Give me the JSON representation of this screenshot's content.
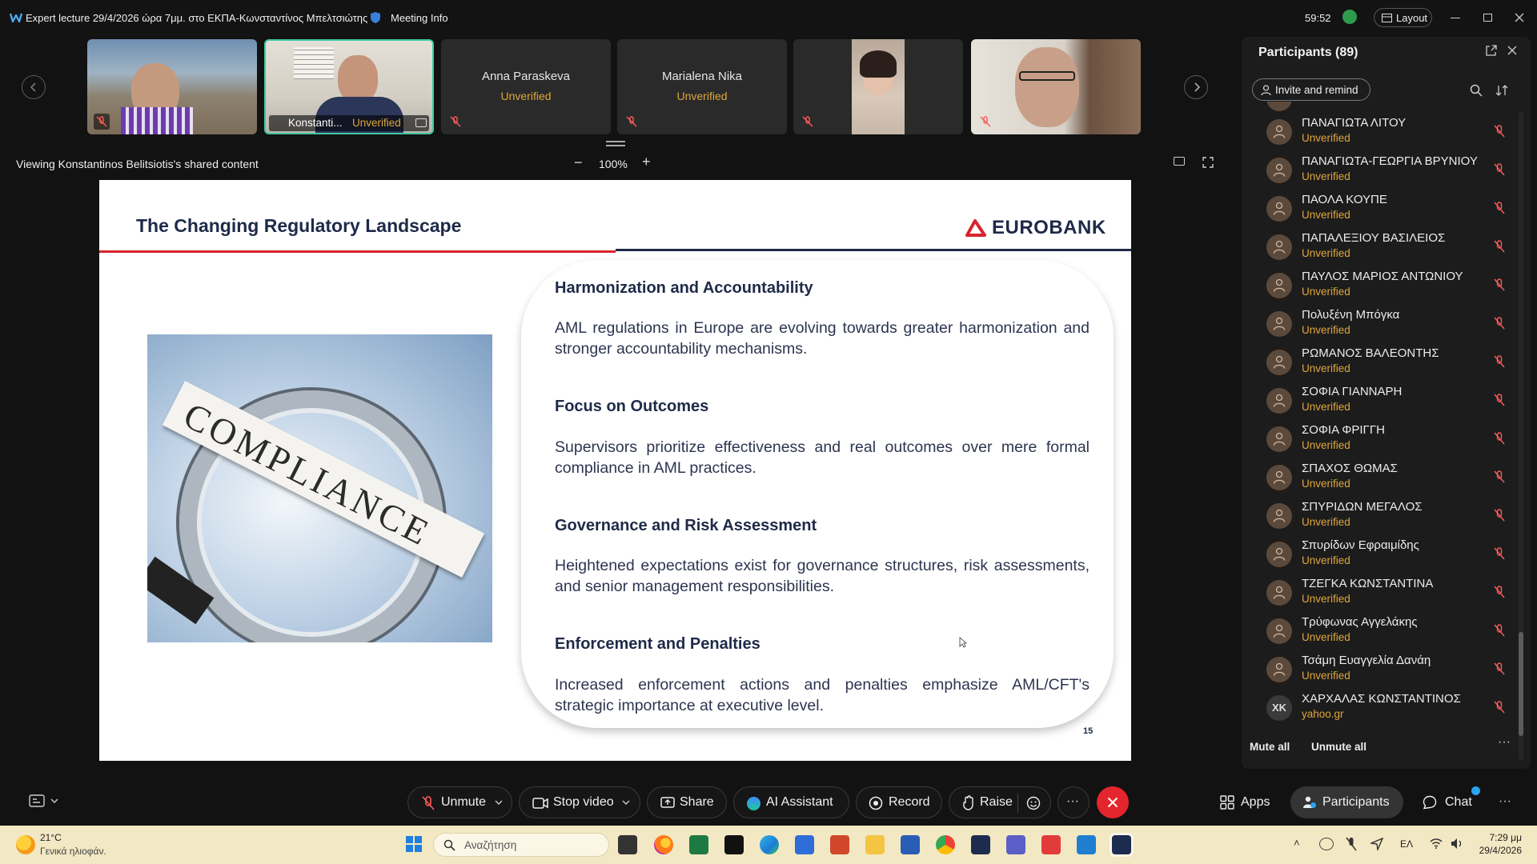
{
  "titlebar": {
    "meeting_title": "Expert lecture 29/4/2026 ώρα 7μμ. στο ΕΚΠΑ-Κωνσταντίνος Μπελτσιώτης",
    "meeting_info": "Meeting Info",
    "timer": "59:52",
    "layout_label": "Layout"
  },
  "video_strip": {
    "tiles": [
      {
        "name": "",
        "status": "",
        "kind": "video"
      },
      {
        "name": "Konstanti...",
        "status": "Unverified",
        "kind": "video-active"
      },
      {
        "name": "Anna Paraskeva",
        "status": "Unverified",
        "kind": "name"
      },
      {
        "name": "Marialena Nika",
        "status": "Unverified",
        "kind": "name"
      },
      {
        "name": "",
        "status": "",
        "kind": "video"
      },
      {
        "name": "",
        "status": "",
        "kind": "video"
      }
    ]
  },
  "share_bar": {
    "viewing_text": "Viewing Konstantinos Belitsiotis's shared content",
    "zoom": "100%",
    "zoom_out": "−",
    "zoom_in": "+"
  },
  "slide": {
    "title": "The Changing Regulatory Landscape",
    "brand": "EUROBANK",
    "image_caption": "COMPLIANCE",
    "sections": [
      {
        "heading": "Harmonization and Accountability",
        "body": "AML regulations in Europe are evolving towards greater harmonization and stronger accountability mechanisms."
      },
      {
        "heading": "Focus on Outcomes",
        "body": "Supervisors prioritize effectiveness and real outcomes over mere formal compliance in AML practices."
      },
      {
        "heading": "Governance and Risk Assessment",
        "body": "Heightened expectations exist for governance structures, risk assessments, and senior management responsibilities."
      },
      {
        "heading": "Enforcement and Penalties",
        "body": "Increased enforcement actions and penalties emphasize AML/CFT's strategic importance at executive level."
      }
    ],
    "page_number": "15"
  },
  "participants": {
    "title": "Participants (89)",
    "invite_label": "Invite and remind",
    "list": [
      {
        "name": "ΠΑΝΑΓΙΩΤΑ ΛΙΤΟΥ",
        "sub": "Unverified",
        "initials": ""
      },
      {
        "name": "ΠΑΝΑΓΙΩΤΑ-ΓΕΩΡΓΙΑ ΒΡΥΝΙΟΥ",
        "sub": "Unverified",
        "initials": ""
      },
      {
        "name": "ΠΑΟΛΑ ΚΟΥΠΕ",
        "sub": "Unverified",
        "initials": ""
      },
      {
        "name": "ΠΑΠΑΛΕΞΙΟΥ ΒΑΣΙΛΕΙΟΣ",
        "sub": "Unverified",
        "initials": ""
      },
      {
        "name": "ΠΑΥΛΟΣ ΜΑΡΙΟΣ ΑΝΤΩΝΙΟΥ",
        "sub": "Unverified",
        "initials": ""
      },
      {
        "name": "Πολυξένη Μπόγκα",
        "sub": "Unverified",
        "initials": ""
      },
      {
        "name": "ΡΩΜΑΝΟΣ ΒΑΛΕΟΝΤΗΣ",
        "sub": "Unverified",
        "initials": ""
      },
      {
        "name": "ΣΟΦΙΑ ΓΙΑΝΝΑΡΗ",
        "sub": "Unverified",
        "initials": ""
      },
      {
        "name": "ΣΟΦΙΑ ΦΡΙΓΓΗ",
        "sub": "Unverified",
        "initials": ""
      },
      {
        "name": "ΣΠΑΧΟΣ ΘΩΜΑΣ",
        "sub": "Unverified",
        "initials": ""
      },
      {
        "name": "ΣΠΥΡΙΔΩΝ ΜΕΓΑΛΟΣ",
        "sub": "Unverified",
        "initials": ""
      },
      {
        "name": "Σπυρίδων Εφραιμίδης",
        "sub": "Unverified",
        "initials": ""
      },
      {
        "name": "ΤΖΕΓΚΑ ΚΩΝΣΤΑΝΤΙΝΑ",
        "sub": "Unverified",
        "initials": ""
      },
      {
        "name": "Τρύφωνας Αγγελάκης",
        "sub": "Unverified",
        "initials": ""
      },
      {
        "name": "Τσάμη Ευαγγελία Δανάη",
        "sub": "Unverified",
        "initials": ""
      },
      {
        "name": "ΧΑΡΧΑΛΑΣ ΚΩΝΣΤΑΝΤΙΝΟΣ",
        "sub": "yahoo.gr",
        "initials": "XK"
      }
    ],
    "mute_all": "Mute all",
    "unmute_all": "Unmute all"
  },
  "controls": {
    "unmute": "Unmute",
    "stop_video": "Stop video",
    "share": "Share",
    "ai_assistant": "AI Assistant",
    "record": "Record",
    "raise": "Raise",
    "apps": "Apps",
    "participants": "Participants",
    "chat": "Chat"
  },
  "taskbar": {
    "temperature": "21°C",
    "weather": "Γενικά ηλιοφάν.",
    "search_placeholder": "Αναζήτηση",
    "language": "ΕΛ",
    "time": "7:29 μμ",
    "date": "29/4/2026"
  },
  "colors": {
    "accent_unverified": "#e0a63a",
    "end_call": "#e5252d",
    "brand_red": "#d8242f",
    "brand_navy": "#1e2a48"
  }
}
